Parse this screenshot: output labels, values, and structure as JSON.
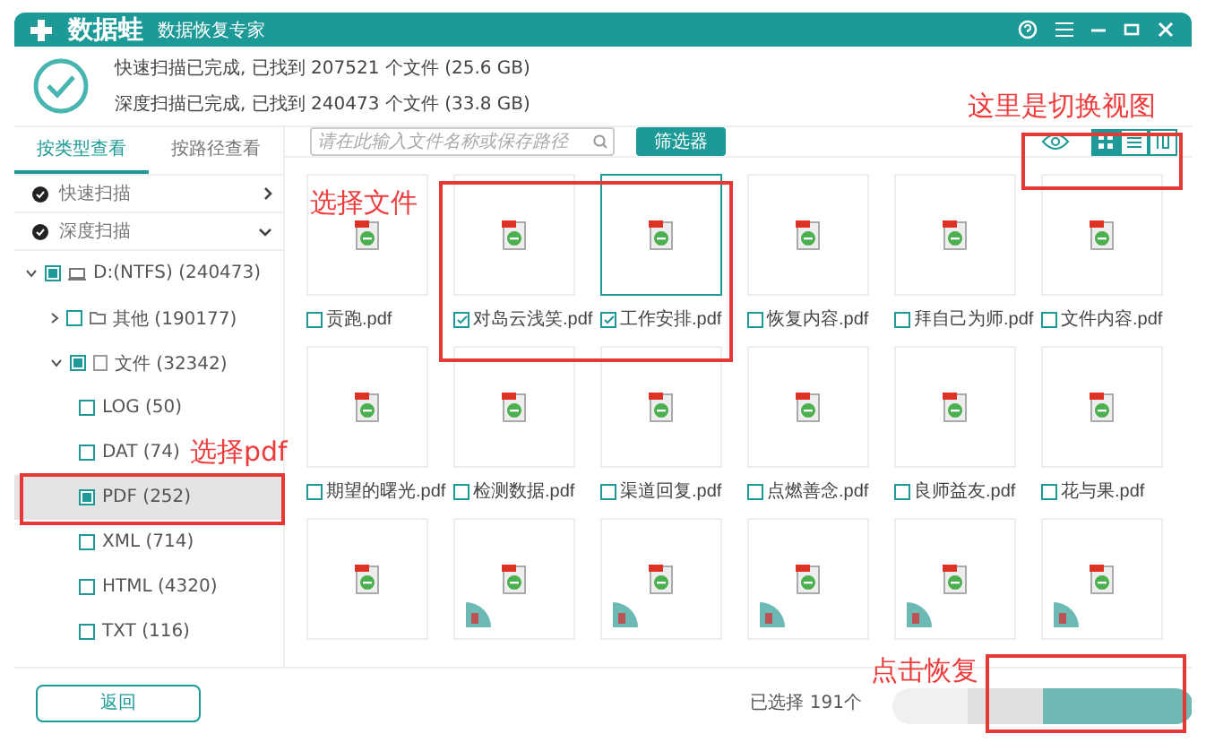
{
  "titlebar": {
    "app_name": "数据蛙",
    "subtitle": "数据恢复专家"
  },
  "scan_summary": [
    "快速扫描已完成, 已找到 207521 个文件 (25.6 GB)",
    "深度扫描已完成, 已找到 240473 个文件 (33.8 GB)"
  ],
  "sidebar": {
    "tabs": [
      {
        "label": "按类型查看",
        "selected": true
      },
      {
        "label": "按路径查看",
        "selected": false
      }
    ],
    "scans": [
      {
        "label": "快速扫描",
        "expanded": false
      },
      {
        "label": "深度扫描",
        "expanded": true
      }
    ],
    "tree": [
      {
        "kind": "drive",
        "label": "D:(NTFS) (240473)",
        "expanded": true,
        "partial": true,
        "selected": false,
        "children": [
          {
            "kind": "folder",
            "label": "其他 (190177)",
            "expanded": false,
            "partial": false,
            "selected": false
          },
          {
            "kind": "doc",
            "label": "文件 (32342)",
            "expanded": true,
            "partial": true,
            "selected": false,
            "children": [
              {
                "kind": "type",
                "label": "LOG (50)",
                "partial": false,
                "selected": false
              },
              {
                "kind": "type",
                "label": "DAT (74)",
                "partial": false,
                "selected": false
              },
              {
                "kind": "type",
                "label": "PDF (252)",
                "partial": true,
                "selected": true
              },
              {
                "kind": "type",
                "label": "XML (714)",
                "partial": false,
                "selected": false
              },
              {
                "kind": "type",
                "label": "HTML (4320)",
                "partial": false,
                "selected": false
              },
              {
                "kind": "type",
                "label": "TXT (116)",
                "partial": false,
                "selected": false
              }
            ]
          }
        ]
      }
    ]
  },
  "toolbar": {
    "search": {
      "placeholder": "请在此输入文件名称或保存路径"
    },
    "filter_button": "筛选器",
    "views": [
      {
        "kind": "grid",
        "selected": true
      },
      {
        "kind": "list",
        "selected": false
      },
      {
        "kind": "detail",
        "selected": false
      }
    ]
  },
  "files": [
    {
      "name": "贡跑.pdf",
      "checked": false,
      "focused": false,
      "badge": false
    },
    {
      "name": "对岛云浅笑.pdf",
      "checked": true,
      "focused": false,
      "badge": false
    },
    {
      "name": "工作安排.pdf",
      "checked": true,
      "focused": true,
      "badge": false
    },
    {
      "name": "恢复内容.pdf",
      "checked": false,
      "focused": false,
      "badge": false
    },
    {
      "name": "拜自己为师.pdf",
      "checked": false,
      "focused": false,
      "badge": false
    },
    {
      "name": "文件内容.pdf",
      "checked": false,
      "focused": false,
      "badge": false
    },
    {
      "name": "期望的曙光.pdf",
      "checked": false,
      "focused": false,
      "badge": false
    },
    {
      "name": "检测数据.pdf",
      "checked": false,
      "focused": false,
      "badge": false
    },
    {
      "name": "渠道回复.pdf",
      "checked": false,
      "focused": false,
      "badge": false
    },
    {
      "name": "点燃善念.pdf",
      "checked": false,
      "focused": false,
      "badge": false
    },
    {
      "name": "良师益友.pdf",
      "checked": false,
      "focused": false,
      "badge": false
    },
    {
      "name": "花与果.pdf",
      "checked": false,
      "focused": false,
      "badge": false
    },
    {
      "focused": false,
      "badge": false
    },
    {
      "focused": false,
      "badge": true
    },
    {
      "focused": false,
      "badge": true
    },
    {
      "focused": false,
      "badge": true
    },
    {
      "focused": false,
      "badge": true
    },
    {
      "focused": false,
      "badge": true
    }
  ],
  "footer": {
    "back_button": "返回",
    "status": "已选择 191个"
  },
  "annotations": [
    "选择文件",
    "选择pdf",
    "这里是切换视图",
    "点击恢复"
  ]
}
